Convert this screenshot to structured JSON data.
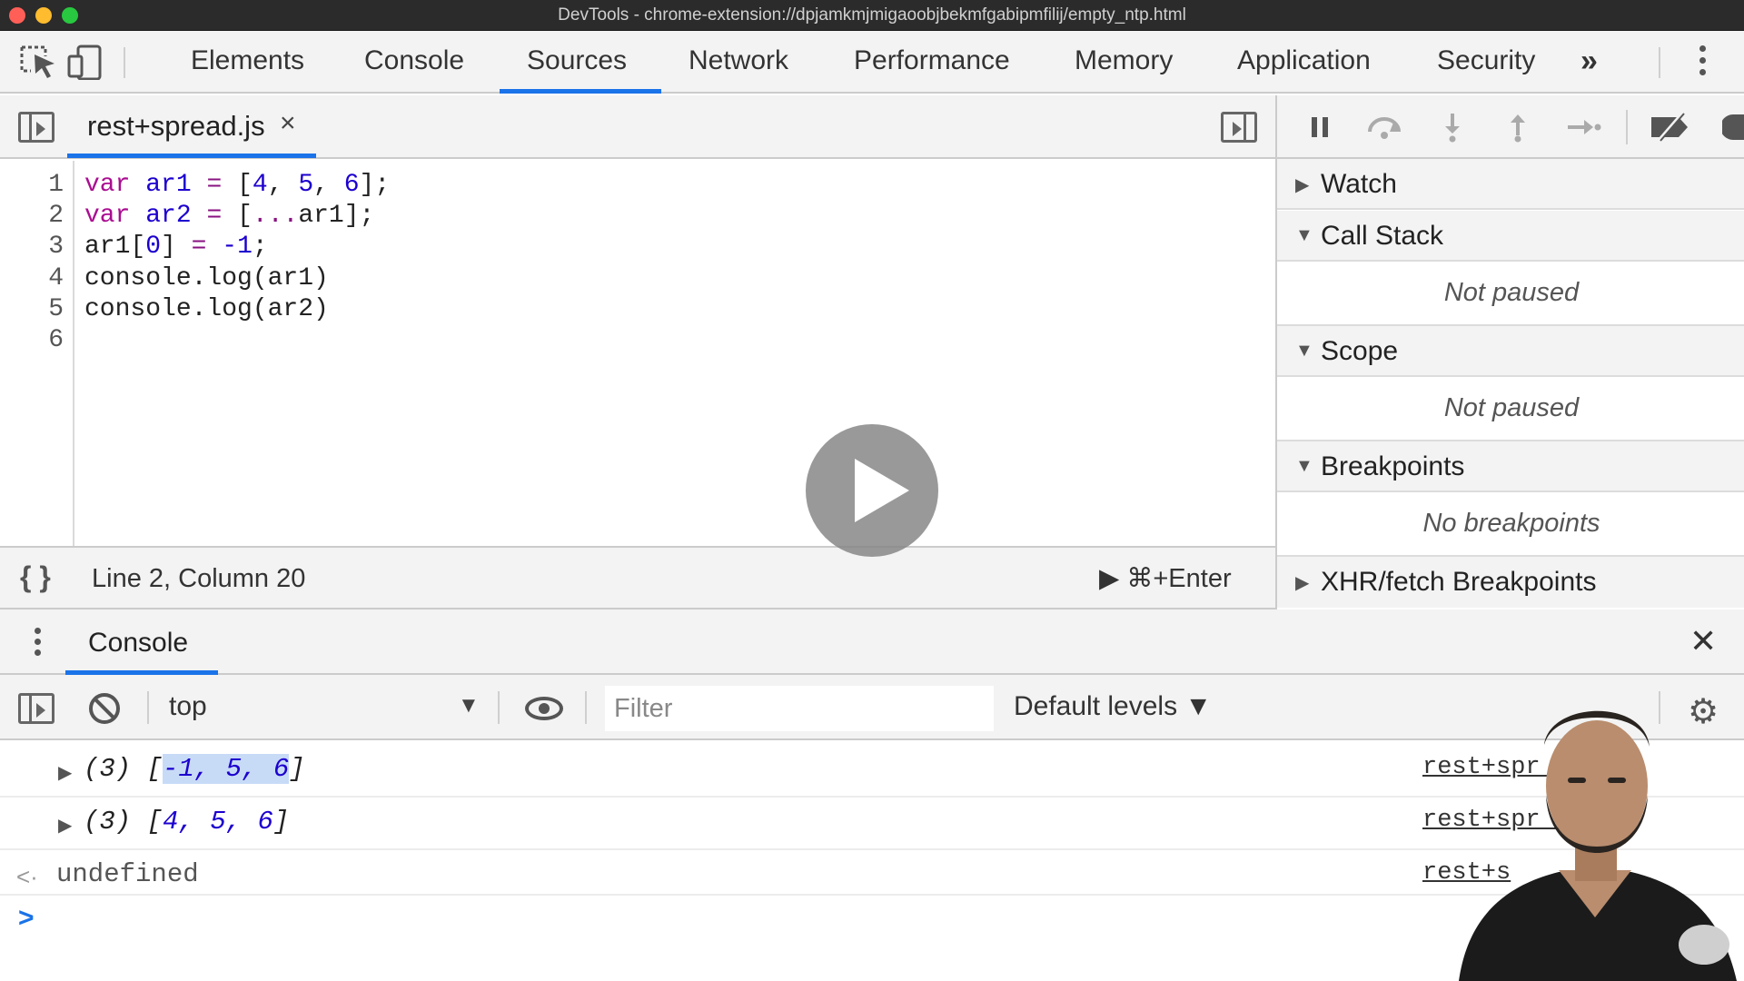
{
  "window": {
    "title": "DevTools - chrome-extension://dpjamkmjmigaoobjbekmfgabipmfilij/empty_ntp.html"
  },
  "main_tabs": [
    {
      "label": "Elements"
    },
    {
      "label": "Console"
    },
    {
      "label": "Sources"
    },
    {
      "label": "Network"
    },
    {
      "label": "Performance"
    },
    {
      "label": "Memory"
    },
    {
      "label": "Application"
    },
    {
      "label": "Security"
    }
  ],
  "active_main_tab": "Sources",
  "more_tabs": "»",
  "sources": {
    "file_tab": {
      "label": "rest+spread.js",
      "close": "×"
    },
    "editor": {
      "line_numbers": [
        "1",
        "2",
        "3",
        "4",
        "5",
        "6"
      ]
    },
    "status": {
      "braces": "{ }",
      "position": "Line 2, Column 20",
      "run_shortcut": "▶ ⌘+Enter"
    }
  },
  "code": {
    "line1": {
      "kw": "var",
      "name": "ar1",
      "eq": " = ",
      "open": "[",
      "n1": "4",
      "sep1": ", ",
      "n2": "5",
      "sep2": ", ",
      "n3": "6",
      "close": "];"
    },
    "line2": {
      "kw": "var",
      "name": "ar2",
      "eq": " = ",
      "open": "[",
      "spread": "...",
      "rest": "ar1];"
    },
    "line3": {
      "head": "ar1[",
      "idx": "0",
      "mid": "] ",
      "eq": "=",
      "sp": " ",
      "neg": "-1",
      "tail": ";"
    },
    "line4": "console.log(ar1)",
    "line5": "console.log(ar2)",
    "line6": ""
  },
  "debugger": {
    "sections": {
      "watch": "Watch",
      "call_stack": "Call Stack",
      "scope": "Scope",
      "breakpoints": "Breakpoints",
      "xhr": "XHR/fetch Breakpoints"
    },
    "call_stack_empty": "Not paused",
    "scope_empty": "Not paused",
    "breakpoints_empty": "No breakpoints"
  },
  "drawer": {
    "tab": "Console",
    "close": "✕",
    "context": "top",
    "filter_placeholder": "Filter",
    "levels": "Default levels ▼"
  },
  "console_rows": [
    {
      "count": "(3) ",
      "open": "[",
      "values": "-1, 5, 6",
      "close": "]",
      "source": "rest+spr      :4"
    },
    {
      "count": "(3) ",
      "open": "[",
      "values": "4, 5, 6",
      "close": "]",
      "source": "rest+spr      :5"
    },
    {
      "return_value": "undefined",
      "source": "rest+s"
    }
  ],
  "colors": {
    "accent": "#1a73e8",
    "keyword": "#aa0d91",
    "number": "#1c00cf",
    "selection": "#c7dbf7"
  }
}
